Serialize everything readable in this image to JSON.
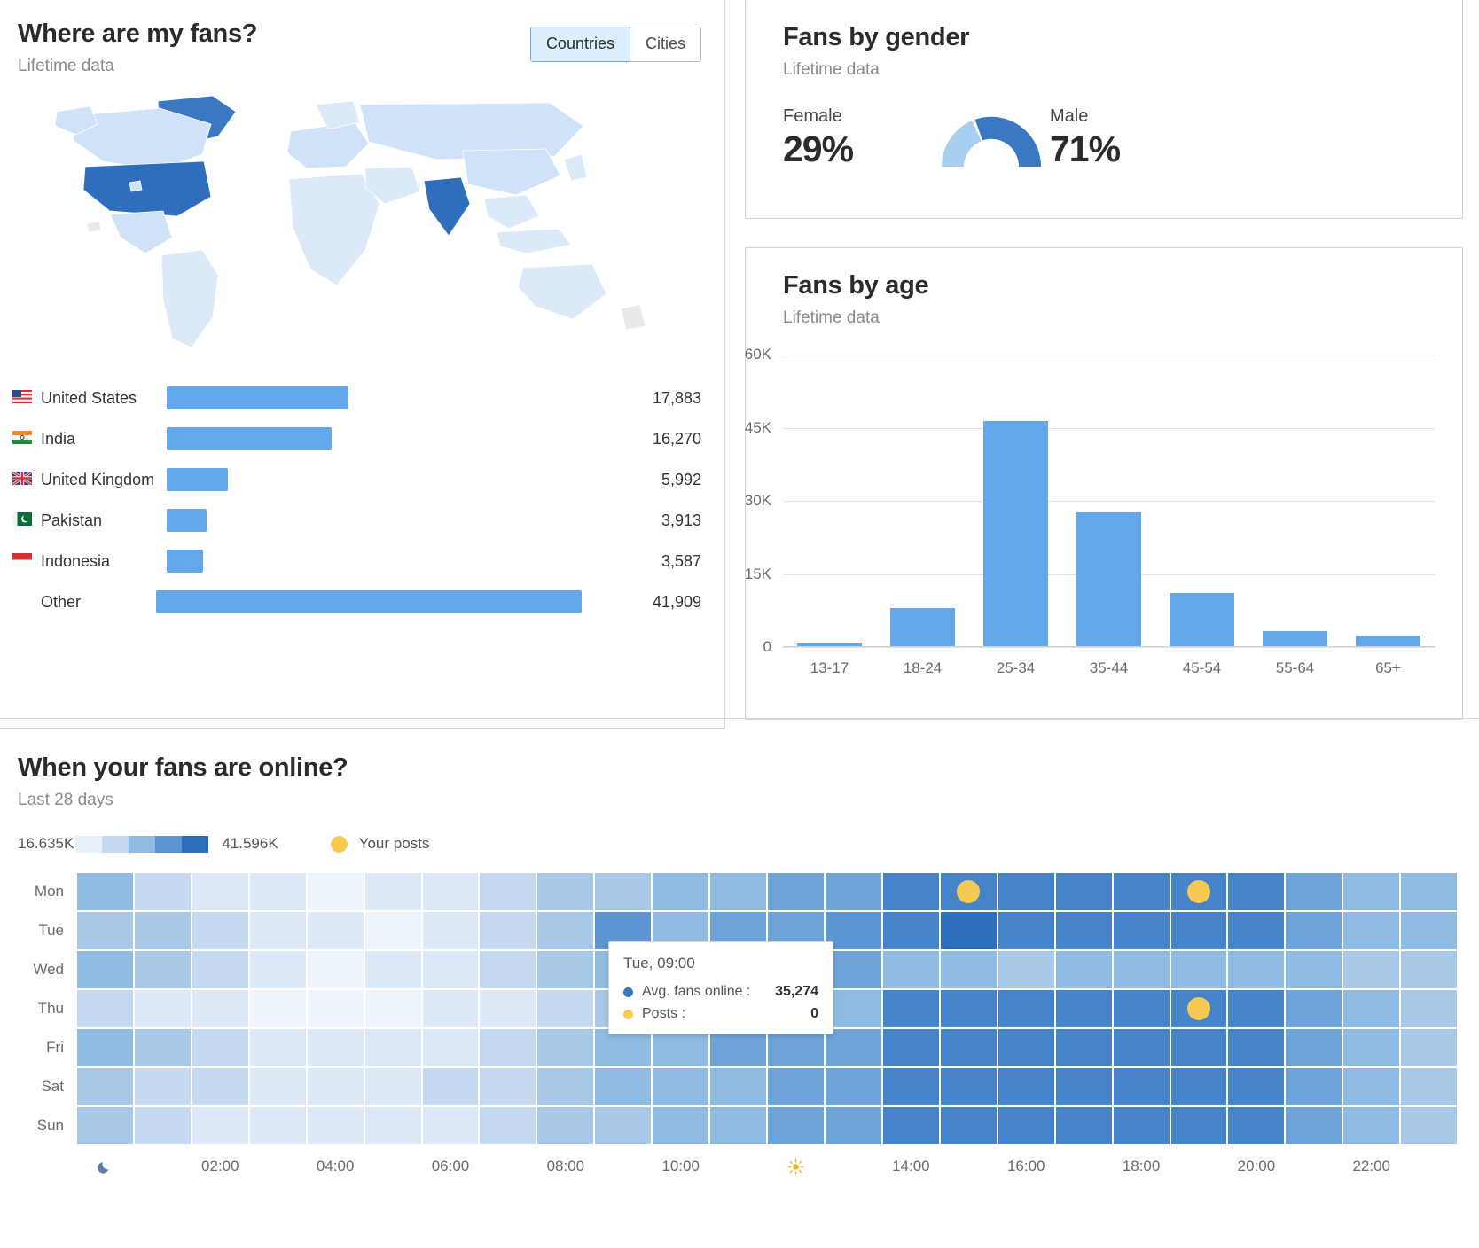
{
  "colors": {
    "bar_blue": "#62a8ea",
    "dark_blue": "#3b78c3",
    "light_blue": "#a8cff0",
    "yellow": "#f6c952"
  },
  "geo_panel": {
    "title": "Where are my fans?",
    "subtitle": "Lifetime data",
    "toggle": {
      "options": [
        "Countries",
        "Cities"
      ],
      "selected": "Countries"
    },
    "rows": [
      {
        "flag": "flag-us",
        "name": "United States",
        "value": "17,883",
        "number": 17883
      },
      {
        "flag": "flag-in",
        "name": "India",
        "value": "16,270",
        "number": 16270
      },
      {
        "flag": "flag-gb",
        "name": "United Kingdom",
        "value": "5,992",
        "number": 5992
      },
      {
        "flag": "flag-pk",
        "name": "Pakistan",
        "value": "3,913",
        "number": 3913
      },
      {
        "flag": "flag-id",
        "name": "Indonesia",
        "value": "3,587",
        "number": 3587
      },
      {
        "flag": "",
        "name": "Other",
        "value": "41,909",
        "number": 41909
      }
    ]
  },
  "gender_panel": {
    "title": "Fans by gender",
    "subtitle": "Lifetime data",
    "female_label": "Female",
    "female_pct": "29%",
    "male_label": "Male",
    "male_pct": "71%"
  },
  "age_panel": {
    "title": "Fans by age",
    "subtitle": "Lifetime data"
  },
  "online_panel": {
    "title": "When your fans are online?",
    "subtitle": "Last 28 days",
    "legend": {
      "min": "16.635K",
      "max": "41.596K",
      "posts_label": "Your posts"
    },
    "tooltip": {
      "header": "Tue, 09:00",
      "rows": [
        {
          "marker": "#3b78c3",
          "key": "Avg. fans online :",
          "value": "35,274"
        },
        {
          "marker": "#f6c952",
          "key": "Posts :",
          "value": "0"
        }
      ]
    }
  },
  "chart_data": [
    {
      "type": "bar",
      "title": "Fans by age",
      "subtitle": "Lifetime data",
      "orientation": "vertical",
      "categories": [
        "13-17",
        "18-24",
        "25-34",
        "35-44",
        "45-54",
        "55-64",
        "65+"
      ],
      "values": [
        700,
        7800,
        46200,
        27400,
        11000,
        3100,
        2100
      ],
      "ylabel": "",
      "xlabel": "",
      "ylim": [
        0,
        60000
      ],
      "yticks": [
        0,
        15000,
        30000,
        45000,
        60000
      ],
      "ytick_labels": [
        "0",
        "15K",
        "30K",
        "45K",
        "60K"
      ],
      "grid": true,
      "legend": "none",
      "color": "#62a8ea"
    },
    {
      "type": "bar",
      "title": "Where are my fans?",
      "subtitle": "Lifetime data",
      "orientation": "horizontal",
      "categories": [
        "United States",
        "India",
        "United Kingdom",
        "Pakistan",
        "Indonesia",
        "Other"
      ],
      "values": [
        17883,
        16270,
        5992,
        3913,
        3587,
        41909
      ],
      "value_labels": [
        "17,883",
        "16,270",
        "5,992",
        "3,913",
        "3,587",
        "41,909"
      ],
      "grid": false,
      "legend": "none",
      "color": "#62a8ea"
    },
    {
      "type": "pie",
      "title": "Fans by gender",
      "subtitle": "Lifetime data",
      "variant": "half-donut-gauge",
      "labels": [
        "Female",
        "Male"
      ],
      "values": [
        29,
        71
      ],
      "value_labels": [
        "29%",
        "71%"
      ],
      "colors": [
        "#a8cff0",
        "#3b78c3"
      ],
      "units": "percent"
    },
    {
      "type": "heatmap",
      "title": "When your fans are online?",
      "subtitle": "Last 28 days",
      "ylabel": "",
      "xlabel": "",
      "y_categories": [
        "Mon",
        "Tue",
        "Wed",
        "Thu",
        "Fri",
        "Sat",
        "Sun"
      ],
      "x_categories": [
        "00:00",
        "01:00",
        "02:00",
        "03:00",
        "04:00",
        "05:00",
        "06:00",
        "07:00",
        "08:00",
        "09:00",
        "10:00",
        "11:00",
        "12:00",
        "13:00",
        "14:00",
        "15:00",
        "16:00",
        "17:00",
        "18:00",
        "19:00",
        "20:00",
        "21:00",
        "22:00",
        "23:00"
      ],
      "x_tick_labels": [
        "moon-icon",
        "",
        "02:00",
        "",
        "04:00",
        "",
        "06:00",
        "",
        "08:00",
        "",
        "10:00",
        "",
        "sun-icon",
        "",
        "14:00",
        "",
        "16:00",
        "",
        "18:00",
        "",
        "20:00",
        "",
        "22:00",
        ""
      ],
      "colorbar": {
        "min": 16635,
        "max": 41596,
        "min_label": "16.635K",
        "max_label": "41.596K",
        "steps": [
          "#e8f1fa",
          "#c5daf0",
          "#8fbbe2",
          "#5c95d2",
          "#2f6ebc"
        ]
      },
      "values": [
        [
          28000,
          24000,
          21000,
          19000,
          18000,
          18500,
          20000,
          22000,
          25000,
          27000,
          28500,
          30000,
          31000,
          33000,
          38000,
          39500,
          38500,
          38000,
          38500,
          39000,
          38000,
          33000,
          30000,
          29000
        ],
        [
          27500,
          24500,
          21500,
          19500,
          18200,
          18000,
          20500,
          23000,
          26000,
          35274,
          30000,
          31500,
          33000,
          34000,
          39500,
          40500,
          39500,
          39000,
          39500,
          40000,
          38500,
          33500,
          30500,
          29500
        ],
        [
          28500,
          25000,
          22000,
          19000,
          18000,
          18500,
          21000,
          24000,
          27000,
          28500,
          30500,
          32000,
          33500,
          31000,
          29000,
          28000,
          27500,
          28000,
          29500,
          30000,
          29000,
          28000,
          26500,
          25500
        ],
        [
          22000,
          20000,
          18500,
          17500,
          17000,
          17200,
          18500,
          20500,
          23000,
          24500,
          26000,
          27000,
          28000,
          30000,
          38000,
          39000,
          38500,
          38000,
          39000,
          40000,
          38500,
          33000,
          28000,
          25000
        ],
        [
          28000,
          25500,
          22500,
          20000,
          18500,
          18800,
          21000,
          23500,
          26500,
          28000,
          29500,
          31000,
          32500,
          33500,
          38500,
          39500,
          39000,
          38500,
          39500,
          40000,
          38000,
          32500,
          29000,
          27500
        ],
        [
          27000,
          24000,
          21500,
          19500,
          18500,
          19000,
          21500,
          24000,
          26500,
          28000,
          29000,
          30500,
          32000,
          33000,
          37500,
          39000,
          38500,
          38000,
          39000,
          39500,
          37500,
          32000,
          28500,
          27000
        ],
        [
          26500,
          23500,
          21000,
          19000,
          18200,
          18800,
          21000,
          23500,
          26000,
          27500,
          28500,
          30000,
          31500,
          32500,
          37000,
          38500,
          38000,
          37500,
          38500,
          39000,
          37000,
          31500,
          28000,
          26500
        ]
      ],
      "post_markers": [
        {
          "day": "Mon",
          "hour": "15:00",
          "row": 0,
          "col": 15
        },
        {
          "day": "Mon",
          "hour": "19:00",
          "row": 0,
          "col": 19
        },
        {
          "day": "Thu",
          "hour": "19:00",
          "row": 3,
          "col": 19
        }
      ]
    }
  ]
}
